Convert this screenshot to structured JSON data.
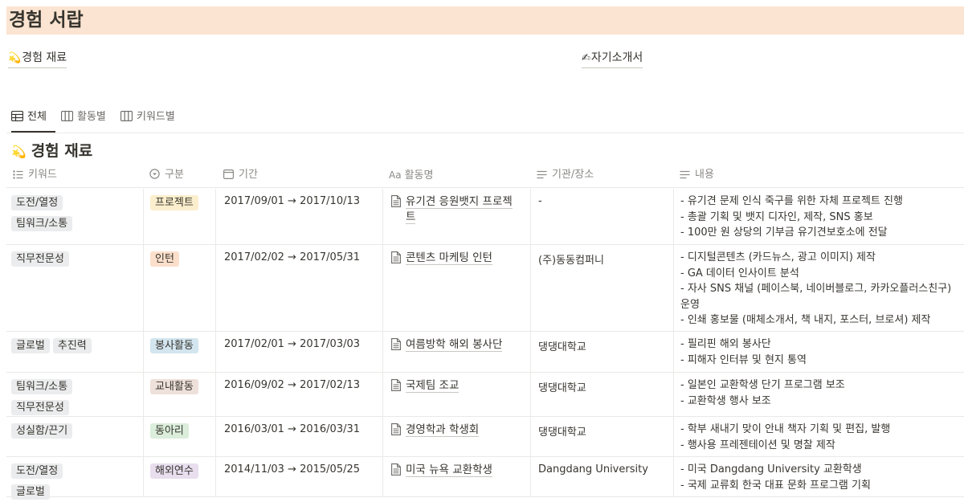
{
  "page": {
    "title": "경험 서랍",
    "links": [
      {
        "emoji": "💫",
        "label": "경험 재료"
      },
      {
        "emoji": "✍",
        "label": "자기소개서"
      }
    ]
  },
  "tabs": [
    {
      "label": "전체",
      "icon": "table-icon",
      "active": true
    },
    {
      "label": "활동별",
      "icon": "board-icon",
      "active": false
    },
    {
      "label": "키워드별",
      "icon": "board-icon",
      "active": false
    }
  ],
  "database": {
    "emoji": "💫",
    "title": "경험 재료",
    "columns": [
      {
        "label": "키워드",
        "icon": "multi-select-icon"
      },
      {
        "label": "구분",
        "icon": "select-icon"
      },
      {
        "label": "기간",
        "icon": "calendar-icon"
      },
      {
        "label": "활동명",
        "icon": "title-aa-icon"
      },
      {
        "label": "기관/장소",
        "icon": "text-lines-icon"
      },
      {
        "label": "내용",
        "icon": "text-lines-icon"
      }
    ],
    "rows": [
      {
        "keywords": [
          [
            "도전/열정",
            "gray"
          ],
          [
            "팀워크/소통",
            "gray"
          ]
        ],
        "type": [
          "프로젝트",
          "yellow"
        ],
        "date": "2017/09/01 → 2017/10/13",
        "name_lines": [
          "유기견 응원뱃지 프로젝",
          "트"
        ],
        "org": "-",
        "desc": [
          "- 유기견 문제 인식 죽구를 위한 자체 프로젝트 진행",
          "- 총괄 기획 및 뱃지 디자인, 제작, SNS 홍보",
          "- 100만 원 상당의 기부금 유기견보호소에 전달"
        ]
      },
      {
        "keywords": [
          [
            "직무전문성",
            "gray"
          ]
        ],
        "type": [
          "인턴",
          "orange"
        ],
        "date": "2017/02/02 → 2017/05/31",
        "name_lines": [
          "콘텐츠 마케팅 인턴"
        ],
        "org": "(주)동동컴퍼니",
        "desc": [
          "- 디지털콘텐츠 (카드뉴스, 광고 이미지) 제작",
          "- GA 데이터 인사이트 분석",
          "- 자사 SNS 채널 (페이스북, 네이버블로그, 카카오플러스친구)",
          "운영",
          "- 인쇄 홍보물 (매체소개서, 책 내지, 포스터, 브로셔) 제작"
        ]
      },
      {
        "keywords": [
          [
            "글로벌",
            "gray"
          ],
          [
            "추진력",
            "gray"
          ]
        ],
        "type": [
          "봉사활동",
          "blue"
        ],
        "date": "2017/02/01 → 2017/03/03",
        "name_lines": [
          "여름방학 해외 봉사단"
        ],
        "org": "댕댕대학교",
        "desc": [
          "- 필리핀 해외 봉사단",
          "- 피해자 인터뷰 및 현지 통역"
        ]
      },
      {
        "keywords": [
          [
            "팀워크/소통",
            "gray"
          ],
          [
            "직무전문성",
            "gray"
          ]
        ],
        "type": [
          "교내활동",
          "brown"
        ],
        "date": "2016/09/02 → 2017/02/13",
        "name_lines": [
          "국제팀 조교"
        ],
        "org": "댕댕대학교",
        "desc": [
          "- 일본인 교환학생 단기 프로그램 보조",
          "- 교환학생 행사 보조"
        ]
      },
      {
        "keywords": [
          [
            "성실함/끈기",
            "gray"
          ]
        ],
        "type": [
          "동아리",
          "green"
        ],
        "date": "2016/03/01 → 2016/03/31",
        "name_lines": [
          "경영학과 학생회"
        ],
        "org": "댕댕대학교",
        "desc": [
          "- 학부 새내기 맞이 안내 책자 기획 및 편집, 발행",
          "- 행사용 프레젠테이션 및 명찰 제작"
        ]
      },
      {
        "keywords": [
          [
            "도전/열정",
            "gray"
          ],
          [
            "글로벌",
            "gray"
          ]
        ],
        "type": [
          "해외연수",
          "purple"
        ],
        "date": "2014/11/03 → 2015/05/25",
        "name_lines": [
          "미국 뉴욕 교환학생"
        ],
        "org": "Dangdang University",
        "desc": [
          "- 미국 Dangdang University 교환학생",
          "- 국제 교류회 한국 대표 문화 프로그램 기획"
        ]
      }
    ]
  }
}
